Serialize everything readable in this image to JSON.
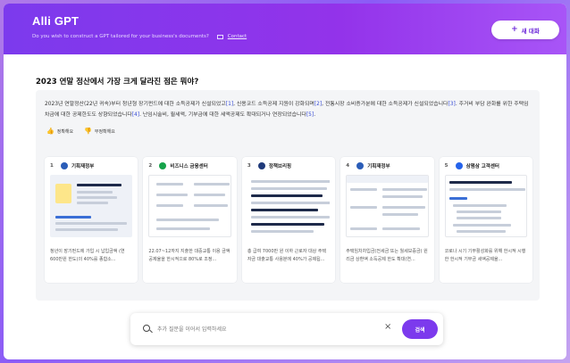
{
  "header": {
    "app_title": "Alli GPT",
    "subtitle": "Do you wish to construct a GPT tailored for your business's documents?",
    "contact_label": "Contact",
    "new_chat_label": "새 대화"
  },
  "question": "2023 연말 정산에서 가장 크게 달라진 점은 뭐야?",
  "answer": {
    "line1_a": "2023년 연말정산(22년 귀속)부터 청년형 장기펀드에 대한 소득공제가 신설되었고",
    "cite1": "[1]",
    "line1_b": ", 신용코드 소득공제 지원이 강화되며",
    "cite2": "[2]",
    "line1_c": ", 전통시장 소비증가분에 대한 소득공제가 신설되었습니다",
    "cite3": "[3]",
    "line1_d": ".",
    "line2_a": "주거비 부담 완화를 위한 주택임차금에 대한 공제한도도 상향되었습니다",
    "cite4": "[4]",
    "line2_b": ". 난임시술비, 월세액, 기부금에 대한 세액공제도 확대되거나 연장되었습니다",
    "cite5": "[5]",
    "line2_c": "."
  },
  "feedback": {
    "helpful_label": "정확해요",
    "unhelpful_label": "부정확해요"
  },
  "sources": [
    {
      "num": "1",
      "name": "기획재정부",
      "icon_color": "#2b5db8",
      "snippet": "청년이 장기펀드에 가입 시 납입금액 (연 600만원 한도)의 40%를 종합소..."
    },
    {
      "num": "2",
      "name": "비즈니스 금융센터",
      "icon_color": "#16a34a",
      "snippet": "22.07~12까지 지출한 대중교통 이용 금액 공제율을 한시적으로 80%로 조정..."
    },
    {
      "num": "3",
      "name": "정책브리핑",
      "icon_color": "#1f3a7a",
      "snippet": "총 급여 7000만 원 이하 근로자 대상 주택 자금 대출교통 사용분에 40%가 공제됩..."
    },
    {
      "num": "4",
      "name": "기획재정부",
      "icon_color": "#2b5db8",
      "snippet": "주택임차차입금(전세금 또는 월세보증금) 원리금 상환액 소득공제 한도 확대(연..."
    },
    {
      "num": "5",
      "name": "삼쩜삼 고객센터",
      "icon_color": "#2563eb",
      "snippet": "코로나 시기 기부활성화를 위해 한시적 시행한 한시적 기부금 세액공제율..."
    }
  ],
  "search": {
    "placeholder": "추가 질문을 이어서 입력하세요",
    "button_label": "검색"
  },
  "colors": {
    "brand": "#7c3aed",
    "citation": "#3b4fd6"
  }
}
